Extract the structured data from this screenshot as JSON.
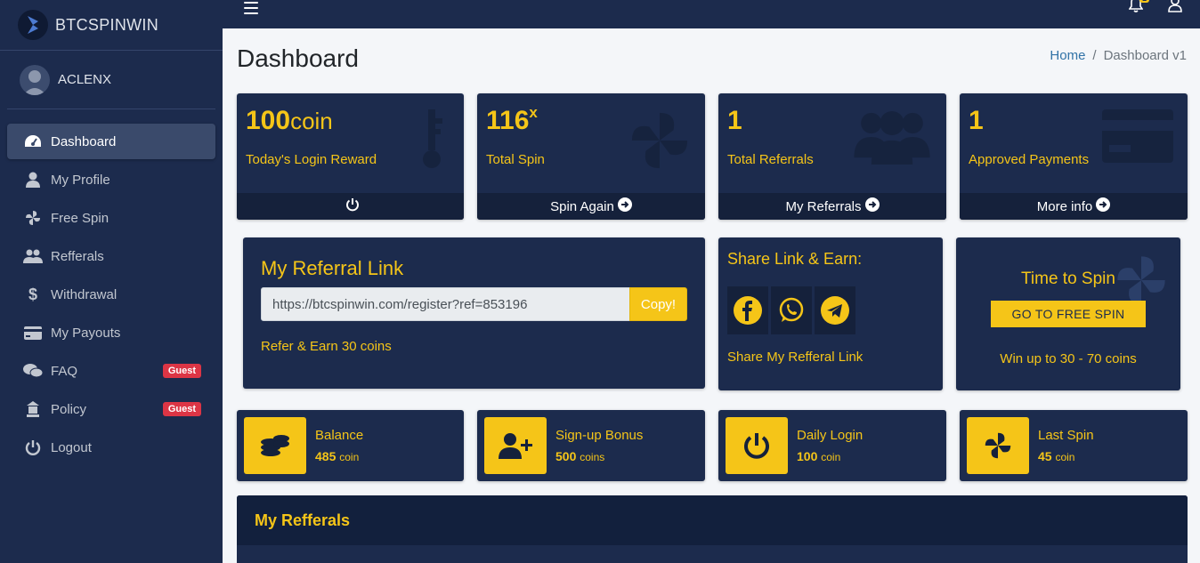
{
  "brand": {
    "name": "BTCSPINWIN"
  },
  "user": {
    "name": "ACLENX"
  },
  "nav": {
    "items": [
      {
        "label": "Dashboard",
        "icon": "tachometer-icon"
      },
      {
        "label": "My Profile",
        "icon": "user-icon"
      },
      {
        "label": "Free Spin",
        "icon": "fan-icon"
      },
      {
        "label": "Refferals",
        "icon": "users-icon"
      },
      {
        "label": "Withdrawal",
        "icon": "dollar-icon"
      },
      {
        "label": "My Payouts",
        "icon": "credit-card-icon"
      },
      {
        "label": "FAQ",
        "icon": "comments-icon",
        "badge": "Guest"
      },
      {
        "label": "Policy",
        "icon": "gavel-icon",
        "badge": "Guest"
      },
      {
        "label": "Logout",
        "icon": "power-icon"
      }
    ]
  },
  "topbar": {
    "notification_count": "1"
  },
  "header": {
    "title": "Dashboard",
    "breadcrumb": {
      "home": "Home",
      "separator": "/",
      "current": "Dashboard v1"
    }
  },
  "small_boxes": [
    {
      "value": "100",
      "unit": "coin",
      "label": "Today's Login Reward",
      "footer": ""
    },
    {
      "value": "116",
      "sup": "x",
      "label": "Total Spin",
      "footer": "Spin Again"
    },
    {
      "value": "1",
      "label": "Total Referrals",
      "footer": "My Referrals"
    },
    {
      "value": "1",
      "label": "Approved Payments",
      "footer": "More info"
    }
  ],
  "referral": {
    "title": "My Referral Link",
    "link": "https://btcspinwin.com/register?ref=853196",
    "copy_label": "Copy!",
    "earn_text": "Refer & Earn 30 coins"
  },
  "share": {
    "title": "Share Link & Earn:",
    "link_text": "Share My Refferal Link"
  },
  "spin": {
    "title": "Time to Spin",
    "button": "GO TO FREE SPIN",
    "sub": "Win up to 30 - 70 coins"
  },
  "info_boxes": [
    {
      "label": "Balance",
      "value": "485",
      "unit": "coin"
    },
    {
      "label": "Sign-up Bonus",
      "value": "500",
      "unit": "coins"
    },
    {
      "label": "Daily Login",
      "value": "100",
      "unit": "coin"
    },
    {
      "label": "Last Spin",
      "value": "45",
      "unit": "coin"
    }
  ],
  "referrals_table": {
    "title": "My Refferals"
  },
  "colors": {
    "accent": "#f5c518",
    "panel": "#1c2b4d",
    "footer": "#15213b",
    "badge": "#dc3545"
  }
}
